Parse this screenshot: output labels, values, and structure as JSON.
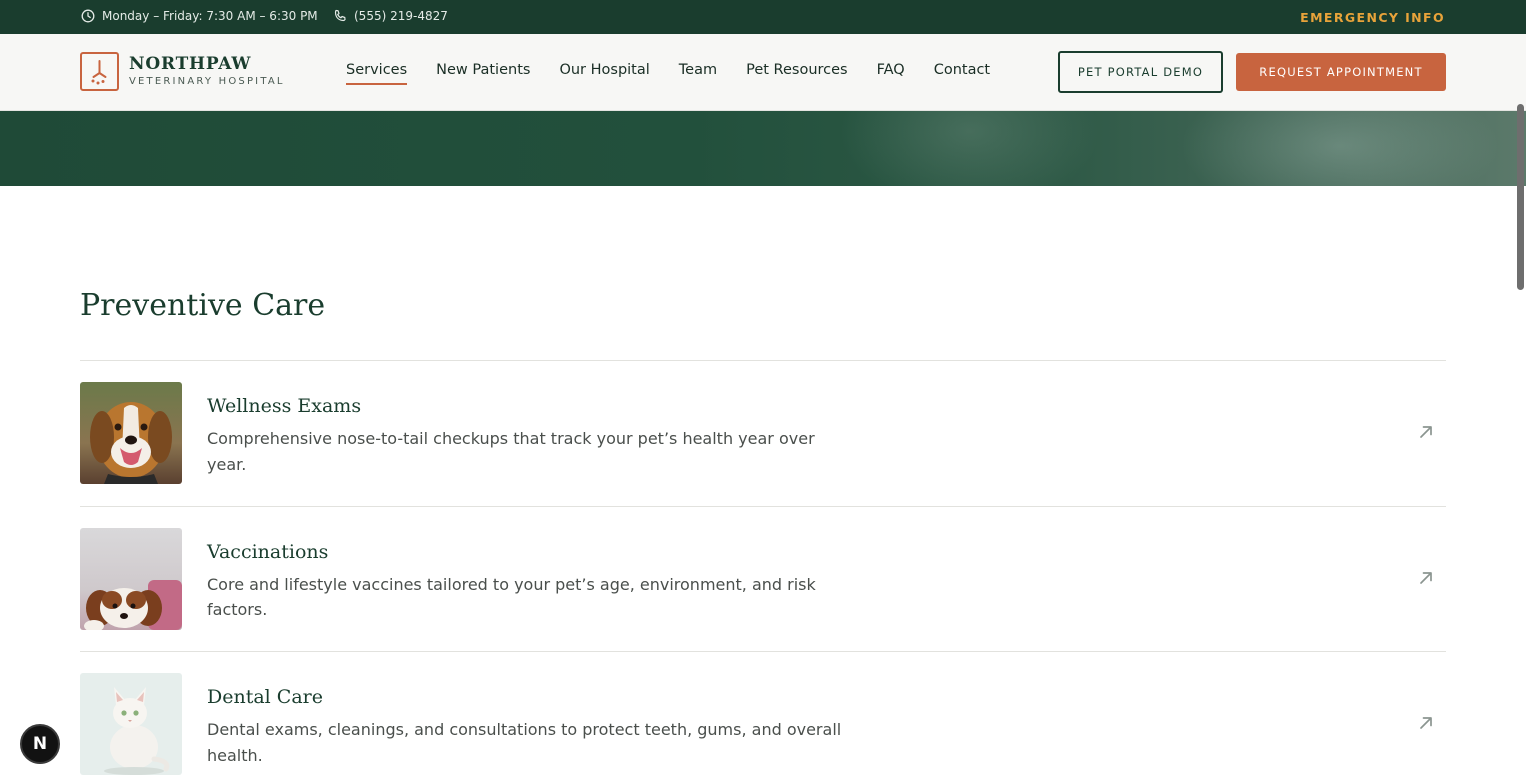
{
  "topbar": {
    "hours": "Monday – Friday: 7:30 AM – 6:30 PM",
    "phone": "(555) 219-4827",
    "emergency": "EMERGENCY INFO"
  },
  "brand": {
    "name": "NORTHPAW",
    "tagline": "VETERINARY HOSPITAL"
  },
  "nav": {
    "items": [
      {
        "label": "Services",
        "active": true
      },
      {
        "label": "New Patients"
      },
      {
        "label": "Our Hospital"
      },
      {
        "label": "Team"
      },
      {
        "label": "Pet Resources"
      },
      {
        "label": "FAQ"
      },
      {
        "label": "Contact"
      }
    ]
  },
  "actions": {
    "portal": "PET PORTAL DEMO",
    "appointment": "REQUEST APPOINTMENT"
  },
  "section": {
    "title": "Preventive Care",
    "items": [
      {
        "title": "Wellness Exams",
        "description": "Comprehensive nose-to-tail checkups that track your pet’s health year over year.",
        "image": "beagle-photo"
      },
      {
        "title": "Vaccinations",
        "description": "Core and lifestyle vaccines tailored to your pet’s age, environment, and risk factors.",
        "image": "puppy-photo"
      },
      {
        "title": "Dental Care",
        "description": "Dental exams, cleanings, and consultations to protect teeth, gums, and overall health.",
        "image": "white-cat-photo"
      }
    ]
  },
  "badge": {
    "letter": "N"
  },
  "colors": {
    "dark_green": "#1a3d2e",
    "accent_orange": "#c8643f",
    "emergency_gold": "#e8a33a"
  }
}
